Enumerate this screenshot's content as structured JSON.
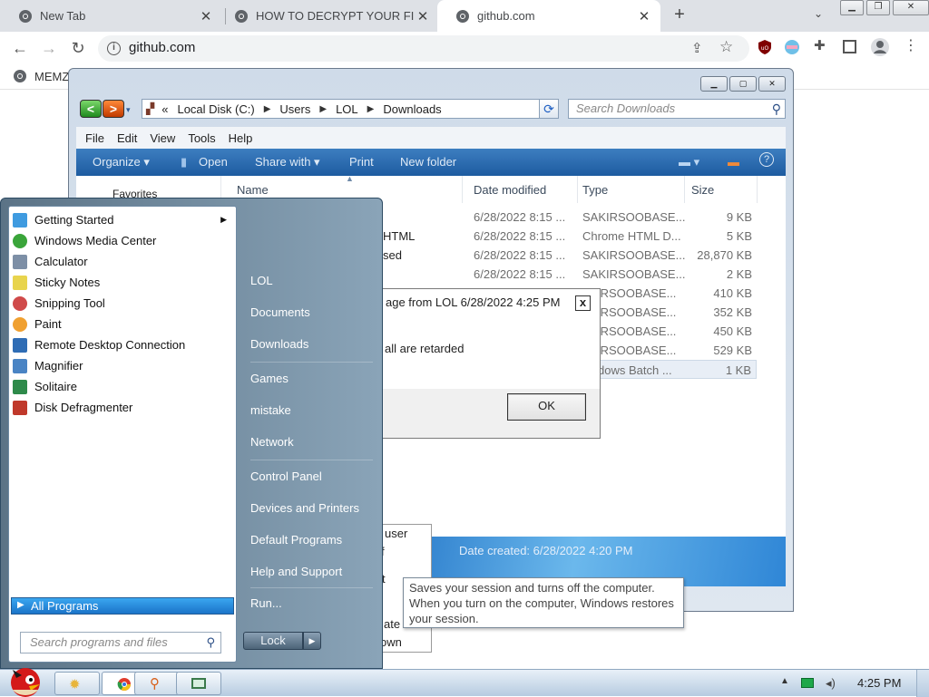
{
  "browser": {
    "tabs": [
      {
        "label": "New Tab"
      },
      {
        "label": "HOW TO DECRYPT YOUR FILES"
      },
      {
        "label": "github.com"
      }
    ],
    "new_tab_symbol": "+",
    "url": "github.com",
    "bookmark": "MEMZ",
    "accent": "#1a73e8"
  },
  "explorer": {
    "address": {
      "root": "Local Disk (C:)",
      "segments": [
        "Users",
        "LOL",
        "Downloads"
      ],
      "prefix": "«"
    },
    "search_placeholder": "Search Downloads",
    "menu": [
      "File",
      "Edit",
      "View",
      "Tools",
      "Help"
    ],
    "commands": {
      "organize": "Organize ▾",
      "open": "Open",
      "share": "Share with ▾",
      "print": "Print",
      "new_folder": "New folder"
    },
    "nav": {
      "favorites": "Favorites"
    },
    "columns": {
      "name": "Name",
      "date": "Date modified",
      "type": "Type",
      "size": "Size"
    },
    "rows": [
      {
        "name": "",
        "date": "6/28/2022 8:15 ...",
        "type": "SAKIRSOOBASE...",
        "size": "9 KB"
      },
      {
        "name": "HTML",
        "date": "6/28/2022 8:15 ...",
        "type": "Chrome HTML D...",
        "size": "5 KB"
      },
      {
        "name": "sed",
        "date": "6/28/2022 8:15 ...",
        "type": "SAKIRSOOBASE...",
        "size": "28,870 KB"
      },
      {
        "name": "",
        "date": "6/28/2022 8:15 ...",
        "type": "SAKIRSOOBASE...",
        "size": "2 KB"
      },
      {
        "name": "",
        "date": "",
        "type": "IRSOOBASE...",
        "size": "410 KB"
      },
      {
        "name": "",
        "date": "",
        "type": "IRSOOBASE...",
        "size": "352 KB"
      },
      {
        "name": "",
        "date": "",
        "type": "IRSOOBASE...",
        "size": "450 KB"
      },
      {
        "name": "",
        "date": "",
        "type": "IRSOOBASE...",
        "size": "529 KB"
      },
      {
        "name": "",
        "date": "",
        "type": "dows Batch ...",
        "size": "1 KB"
      }
    ],
    "details": "Date created: 6/28/2022 4:20 PM"
  },
  "message_box": {
    "title": "age from LOL 6/28/2022 4:25 PM",
    "text": "all are retarded",
    "ok_label": "OK",
    "close_symbol": "x"
  },
  "start_menu": {
    "programs": [
      {
        "label": "Getting Started",
        "has_submenu": true,
        "icon": "getting-started-icon",
        "color": "#3f9be0"
      },
      {
        "label": "Windows Media Center",
        "icon": "media-center-icon",
        "color": "#3aa53a"
      },
      {
        "label": "Calculator",
        "icon": "calculator-icon",
        "color": "#7d8fa6"
      },
      {
        "label": "Sticky Notes",
        "icon": "sticky-notes-icon",
        "color": "#e8d44d"
      },
      {
        "label": "Snipping Tool",
        "icon": "snipping-tool-icon",
        "color": "#d04a4a"
      },
      {
        "label": "Paint",
        "icon": "paint-icon",
        "color": "#f0a030"
      },
      {
        "label": "Remote Desktop Connection",
        "icon": "remote-desktop-icon",
        "color": "#2f6db5"
      },
      {
        "label": "Magnifier",
        "icon": "magnifier-icon",
        "color": "#4a84c4"
      },
      {
        "label": "Solitaire",
        "icon": "solitaire-icon",
        "color": "#2e8a4a"
      },
      {
        "label": "Disk Defragmenter",
        "icon": "disk-defragmenter-icon",
        "color": "#c0392b"
      }
    ],
    "all_programs": "All Programs",
    "search_placeholder": "Search programs and files",
    "right_items": {
      "user": "LOL",
      "documents": "Documents",
      "downloads": "Downloads",
      "games": "Games",
      "mistake": "mistake",
      "network": "Network",
      "control_panel": "Control Panel",
      "devices": "Devices and Printers",
      "default_programs": "Default Programs",
      "help": "Help and Support",
      "run": "Run..."
    },
    "lock_label": "Lock"
  },
  "shutdown_menu": {
    "items": [
      "user",
      "f",
      "t",
      "ate",
      "own"
    ]
  },
  "tooltip": "Saves your session and turns off the computer. When you turn on the computer, Windows restores your session.",
  "taskbar": {
    "time": "4:25 PM",
    "tray_arrow": "▲"
  }
}
